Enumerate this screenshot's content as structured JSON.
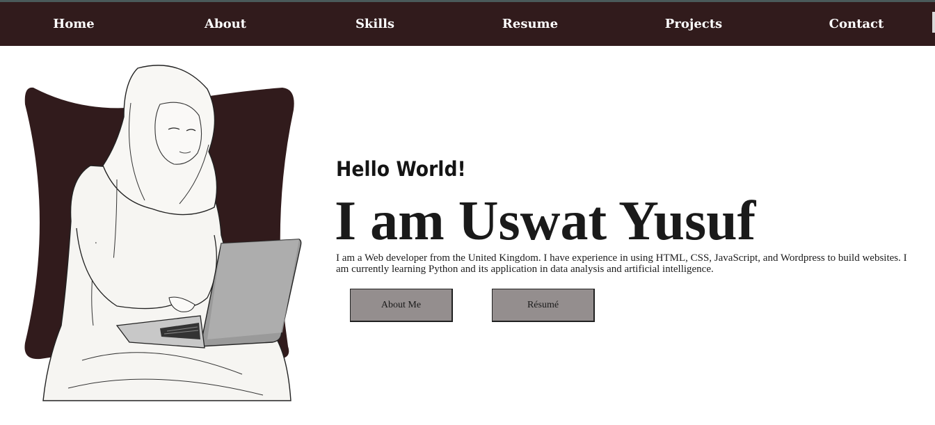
{
  "nav": {
    "items": [
      {
        "label": "Home"
      },
      {
        "label": "About"
      },
      {
        "label": "Skills"
      },
      {
        "label": "Resume"
      },
      {
        "label": "Projects"
      },
      {
        "label": "Contact"
      }
    ]
  },
  "hero": {
    "greeting": "Hello World!",
    "name": "I am Uswat Yusuf",
    "bio_line1": "I am a Web developer from the United Kingdom. I have experience in using HTML, CSS, JavaScript, and Wordpress to build websites. I",
    "bio_line2": "am currently learning Python and its application in data analysis and artificial intelligence.",
    "buttons": {
      "about_label": "About Me",
      "resume_label": "Résumé"
    },
    "illustration": {
      "icon": "woman-with-laptop-illustration",
      "backdrop_color": "#311b1c"
    }
  },
  "colors": {
    "nav_bg": "#311b1c",
    "button_bg": "#948e8e",
    "text": "#1a1a1a"
  }
}
